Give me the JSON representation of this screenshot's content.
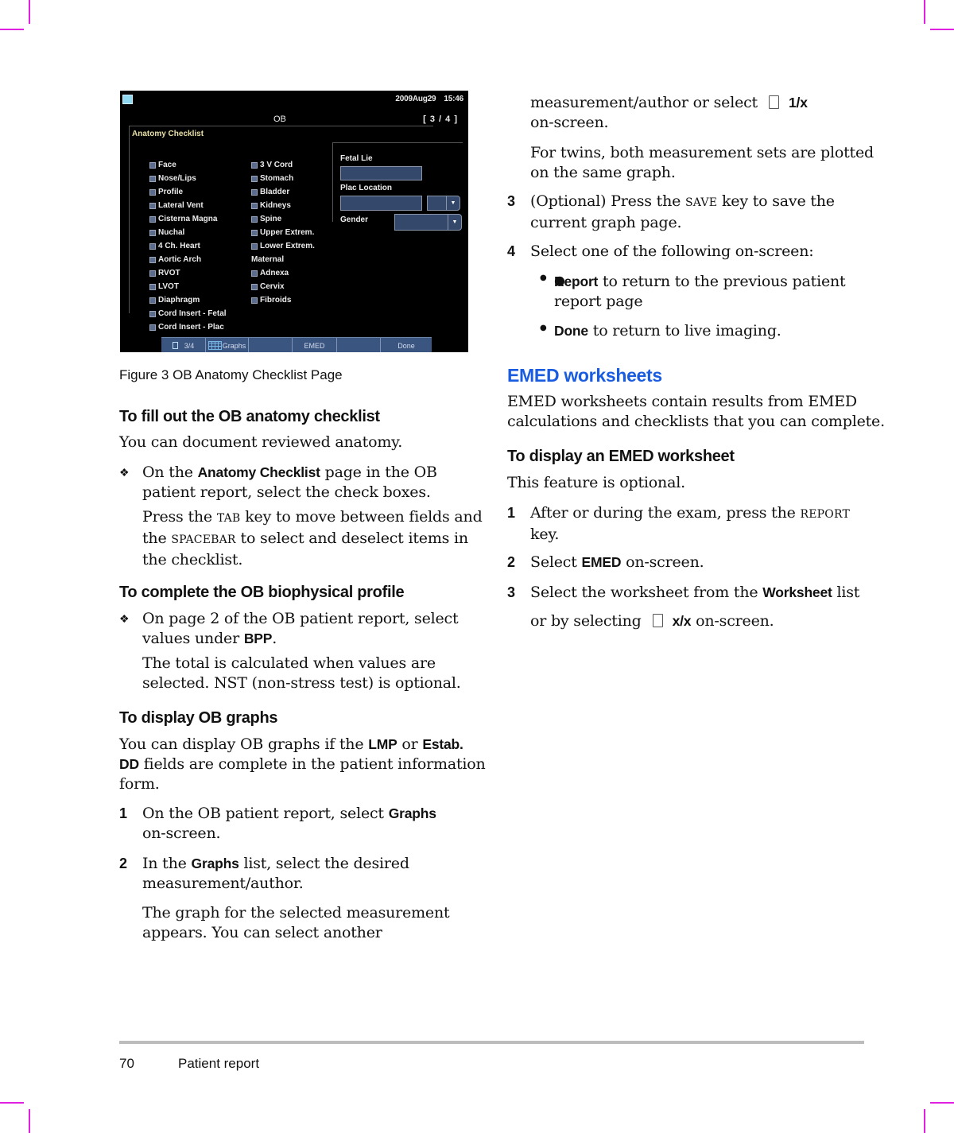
{
  "crop_mark_color": "#e020e0",
  "figure": {
    "screen": {
      "date": "2009Aug29",
      "time": "15:46",
      "mode_title": "OB",
      "page_indicator": "[ 3 / 4 ]",
      "section_title": "Anatomy Checklist",
      "fetal_items": [
        "Face",
        "Nose/Lips",
        "Profile",
        "Lateral Vent",
        "Cisterna Magna",
        "Nuchal",
        "4 Ch. Heart",
        "Aortic Arch",
        "RVOT",
        "LVOT",
        "Diaphragm",
        "Cord Insert - Fetal",
        "Cord Insert - Plac"
      ],
      "fetal_items_col2": [
        "3 V Cord",
        "Stomach",
        "Bladder",
        "Kidneys",
        "Spine",
        "Upper Extrem.",
        "Lower Extrem."
      ],
      "maternal_label": "Maternal",
      "maternal_items": [
        "Adnexa",
        "Cervix",
        "Fibroids"
      ],
      "fields": {
        "fetal_lie_label": "Fetal Lie",
        "fetal_lie_value": "",
        "plac_location_label": "Plac Location",
        "plac_location_value": "",
        "gender_label": "Gender",
        "gender_value": ""
      },
      "bottom_bar": {
        "page": "3/4",
        "graphs": "Graphs",
        "emed": "EMED",
        "done": "Done"
      }
    },
    "caption": "Figure 3  OB Anatomy Checklist Page"
  },
  "left_column": {
    "section1": {
      "heading": "To fill out the OB anatomy checklist",
      "intro": "You can document reviewed anatomy.",
      "step_pre": "On the ",
      "step_bold": "Anatomy Checklist",
      "step_post": " page in the OB",
      "step_line2": "patient report, select the check boxes.",
      "note_l1_pre": "Press the ",
      "note_l1_key": "TAB",
      "note_l1_post": " key to move between fields and",
      "note_l2_pre": "the ",
      "note_l2_key": "SPACEBAR",
      "note_l2_post": " to select and deselect items in",
      "note_l3": "the checklist."
    },
    "section2": {
      "heading": "To complete the OB biophysical profile",
      "step_l1": "On page 2 of the OB patient report, select",
      "step_l2_pre": "values under ",
      "step_l2_bold": "BPP",
      "step_l2_post": ".",
      "note_l1": "The total is calculated when values are",
      "note_l2": "selected. NST (non-stress test) is optional."
    },
    "section3": {
      "heading": "To display OB graphs",
      "intro_l1_pre": "You can display OB graphs if the ",
      "intro_l1_b1": "LMP",
      "intro_l1_mid": " or ",
      "intro_l1_b2": "Estab.",
      "intro_l2_b": "DD",
      "intro_l2_post": " fields are complete in the patient information",
      "intro_l3": "form.",
      "step1_num": "1",
      "step1_pre": "On the OB patient report, select ",
      "step1_bold": "Graphs",
      "step1_l2": "on-screen.",
      "step2_num": "2",
      "step2_pre": "In the ",
      "step2_bold": "Graphs",
      "step2_post": " list, select the desired",
      "step2_l2": "measurement/author.",
      "note_l1": "The graph for the selected measurement",
      "note_l2": "appears. You can select another"
    }
  },
  "right_column": {
    "cont_l1_pre": "measurement/author or select",
    "cont_l1_bold": "1/x",
    "cont_l2": "on-screen.",
    "twins_l1": "For twins, both measurement sets are plotted",
    "twins_l2": "on the same graph.",
    "step3_num": "3",
    "step3_pre": "(Optional) Press the ",
    "step3_key": "SAVE",
    "step3_post": " key to save the",
    "step3_l2": "current graph page.",
    "step4_num": "4",
    "step4_text": "Select one of the following on-screen:",
    "bullet1_bold": "Report",
    "bullet1_post": " to return to the previous patient",
    "bullet1_l2": "report page",
    "bullet2_bold": "Done",
    "bullet2_post": " to return to live imaging.",
    "emed": {
      "heading": "EMED worksheets",
      "heading_color": "#1a5ce0",
      "intro_l1": "EMED worksheets contain results from EMED",
      "intro_l2": "calculations and checklists that you can complete.",
      "sub_heading": "To display an EMED worksheet",
      "optional": "This feature is optional.",
      "s1_num": "1",
      "s1_pre": "After or during the exam, press the ",
      "s1_key": "REPORT",
      "s1_l2": "key.",
      "s2_num": "2",
      "s2_pre": "Select ",
      "s2_bold": "EMED",
      "s2_post": " on-screen.",
      "s3_num": "3",
      "s3_pre": "Select the worksheet from the ",
      "s3_bold": "Worksheet",
      "s3_post": " list",
      "s3_l2_pre": "or by selecting",
      "s3_l2_bold": "x/x",
      "s3_l2_post": " on-screen."
    }
  },
  "footer": {
    "page_number": "70",
    "section_title": "Patient report"
  }
}
